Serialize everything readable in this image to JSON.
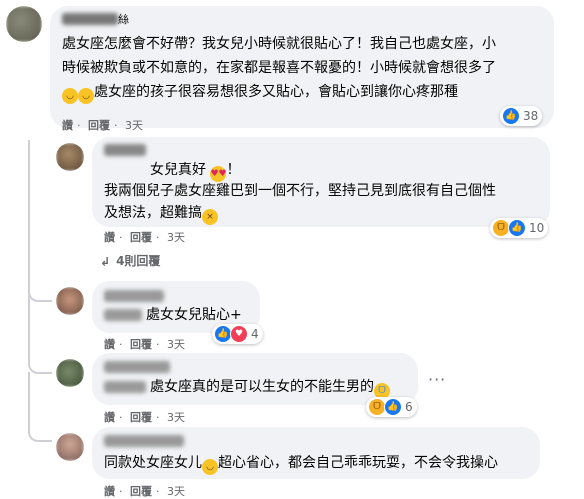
{
  "comments": [
    {
      "name_suffix": "絲",
      "lines": [
        "處女座怎麼會不好帶？我女兒小時候就很貼心了！我自己也處女座，小",
        "時候被欺負或不如意的，在家都是報喜不報憂的！小時候就會想很多了",
        "處女座的孩子很容易想很多又貼心，會貼心到讓你心疼那種"
      ],
      "actions": {
        "like": "讚",
        "reply": "回覆",
        "time": "3天"
      },
      "reaction_count": "38"
    },
    {
      "lines": [
        "女兒真好",
        "！",
        "我兩個兒子處女座雞巴到一個不行，堅持己見到底很有自己個性",
        "及想法，超難搞"
      ],
      "actions": {
        "like": "讚",
        "reply": "回覆",
        "time": "3天"
      },
      "reaction_count": "10",
      "replies_link": "4則回覆"
    },
    {
      "text": "處女女兒貼心+",
      "actions": {
        "like": "讚",
        "reply": "回覆",
        "time": "3天"
      },
      "reaction_count": "4"
    },
    {
      "text": "處女座真的是可以生女的不能生男的",
      "actions": {
        "like": "讚",
        "reply": "回覆",
        "time": "3天"
      },
      "reaction_count": "6",
      "more": "···"
    },
    {
      "text_a": "同款处女座女儿",
      "text_b": "超心省心，都会自己乖乖玩耍，不会令我操心",
      "actions": {
        "like": "讚",
        "reply": "回覆",
        "time": "3天"
      }
    }
  ],
  "separator": "·",
  "icons": {
    "like": "like-icon",
    "heart": "heart-icon",
    "haha": "haha-icon",
    "reply_arrow": "reply-arrow-icon"
  }
}
